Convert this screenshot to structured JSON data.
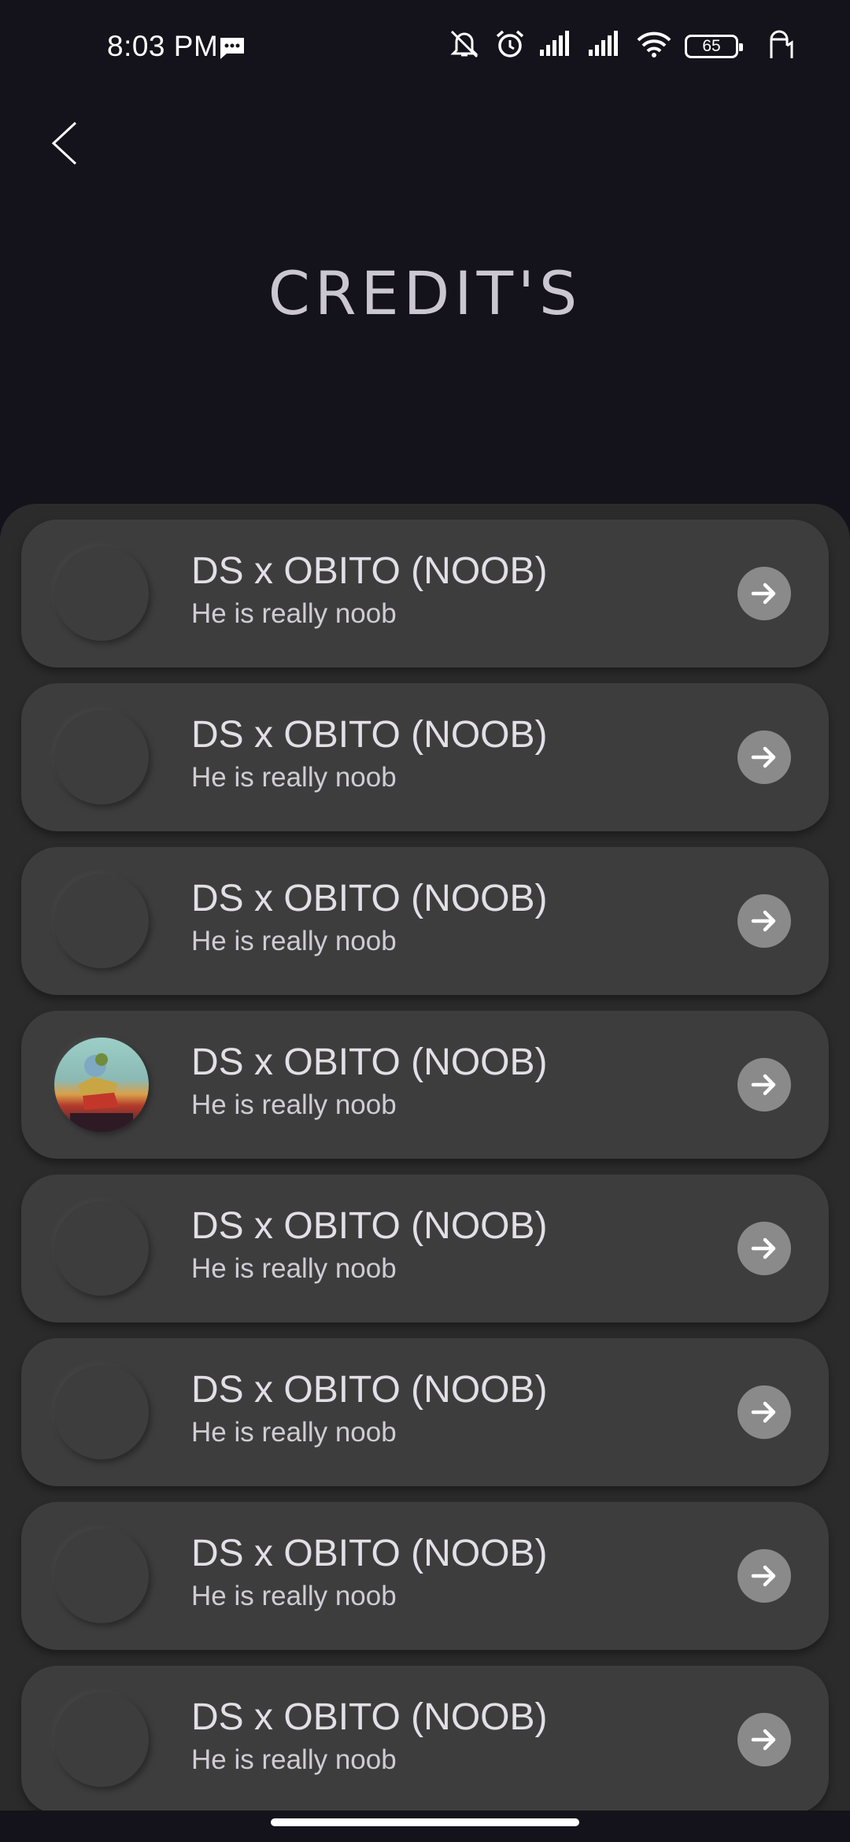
{
  "status_bar": {
    "time": "8:03 PM",
    "battery": "65",
    "icons": [
      "message-icon",
      "mute-icon",
      "alarm-icon",
      "signal-icon",
      "signal-icon",
      "wifi-icon",
      "battery-icon",
      "hand-icon"
    ]
  },
  "header": {
    "title": "CREDIT'S",
    "back_icon": "chevron-left-icon"
  },
  "credits": [
    {
      "name": "DS x OBITO (NOOB)",
      "subtitle": "He is really noob",
      "has_avatar_image": false
    },
    {
      "name": "DS x OBITO (NOOB)",
      "subtitle": "He is really noob",
      "has_avatar_image": false
    },
    {
      "name": "DS x OBITO (NOOB)",
      "subtitle": "He is really noob",
      "has_avatar_image": false
    },
    {
      "name": "DS x OBITO (NOOB)",
      "subtitle": "He is really noob",
      "has_avatar_image": true
    },
    {
      "name": "DS x OBITO (NOOB)",
      "subtitle": "He is really noob",
      "has_avatar_image": false
    },
    {
      "name": "DS x OBITO (NOOB)",
      "subtitle": "He is really noob",
      "has_avatar_image": false
    },
    {
      "name": "DS x OBITO (NOOB)",
      "subtitle": "He is really noob",
      "has_avatar_image": false
    },
    {
      "name": "DS x OBITO (NOOB)",
      "subtitle": "He is really noob",
      "has_avatar_image": false
    }
  ],
  "colors": {
    "background": "#14121a",
    "panel": "#2b2b2b",
    "card": "#3d3d3d",
    "arrow_button": "#8a8a8a",
    "text": "#e2dfe6"
  }
}
